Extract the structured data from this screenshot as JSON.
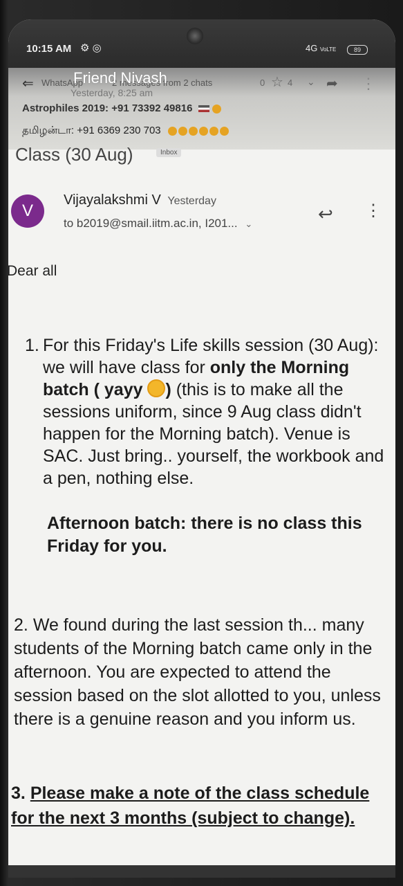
{
  "status_bar": {
    "time": "10:15 AM",
    "icons": "⚙ ◎",
    "network": "4G",
    "network_sub": "VoLTE",
    "battery": "89"
  },
  "notification": {
    "app": "WhatsApp",
    "title": "Friend Nivash",
    "summary": "2 messages from 2 chats",
    "time": "Yesterday, 8:25 am",
    "count_left": "0",
    "count_right": "4",
    "line1": "Astrophiles 2019: +91 73392 49816",
    "line2": "தமிழன்டா: +91 6369 230 703"
  },
  "email": {
    "subject": "Class (30 Aug)",
    "label": "Inbox",
    "avatar_letter": "V",
    "sender": "Vijayalakshmi V",
    "time": "Yesterday",
    "recipients": "to b2019@smail.iitm.ac.in, I201...",
    "greeting": "Dear all",
    "item1": {
      "number": "1.",
      "part_a": "For this Friday's Life skills session (30 Aug): we will have class for ",
      "part_b": "only the Morning batch ( yayy ",
      "part_c": ")",
      "part_d": " (this is to make all the sessions uniform, since 9 Aug class didn't happen for the Morning batch). Venue is SAC. Just bring.. yourself, the workbook and a pen, nothing else.",
      "afternoon": "Afternoon batch: there is no class this Friday for you."
    },
    "item2": {
      "number": "2.",
      "text": "We found during the last session th... many students of the Morning batch came only in the afternoon. You are expected to attend the session based on the slot allotted to you, unless there is a genuine reason and you inform us."
    },
    "item3": {
      "number": "3.",
      "text": "Please make a note of the class schedule for the next 3 months (subject to change)."
    }
  },
  "colors": {
    "avatar": "#7b2a8c",
    "background": "#f3f3f1"
  }
}
